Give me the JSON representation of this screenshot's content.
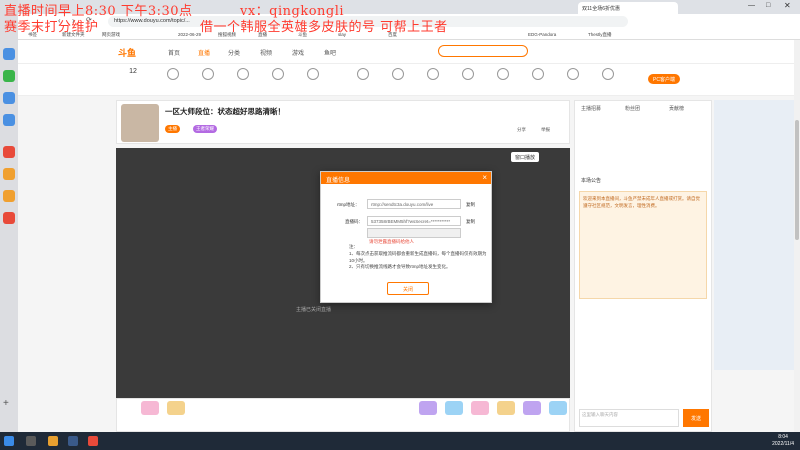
{
  "overlay": {
    "line1": "直播时间早上8:30 下午3:30点",
    "line1b": "vx：qingkongli",
    "line2": "赛季末打分维护",
    "line2b": "借一个韩服全英雄多皮肤的号 可帮上王者"
  },
  "browser": {
    "url": "https://www.douyu.com/topic/...",
    "tab_label": "双11全场6折优惠",
    "bookmarks": [
      "书签",
      "新建文件夹",
      "网页游戏",
      "2022-06-29",
      "",
      "搜狐视频",
      "直播",
      "斗鱼",
      "slay",
      "百度",
      "EDG-Pandora",
      "Thestly直播"
    ]
  },
  "site": {
    "logo": "斗鱼",
    "nav": [
      "首页",
      "直播",
      "分类",
      "视频",
      "游戏",
      "鱼吧"
    ],
    "search_placeholder": "",
    "follow_count": "12",
    "categories": [
      "",
      "",
      "",
      "",
      "",
      "",
      "",
      "",
      "",
      "",
      "",
      "",
      "",
      "",
      "",
      "",
      "",
      ""
    ],
    "pc_client_label": "PC客户端",
    "room_title": "一区大师段位：状态超好思路清晰！",
    "room_tags": [
      "主播",
      "王者荣耀",
      "分享",
      "举报"
    ],
    "window_button": "窗口播放",
    "player_hint": "主播已关闭直播"
  },
  "chat": {
    "tabs": [
      "主播招募",
      "粉丝团",
      "贡献榜"
    ],
    "announce_title": "本场公告",
    "announce_text": "欢迎来到本直播间，斗鱼严禁未成年人直播或打赏。请自觉遵守社区规范，文明发言，理性消费。",
    "input_placeholder": "这里输入聊天内容",
    "send_label": "发送"
  },
  "modal": {
    "title": "直播信息",
    "rtmp_label": "rtmp地址：",
    "rtmp_value": "rtmp://sendtc3a.douyu.com/live",
    "code_label": "直播码：",
    "code_value": "537358rBEMM5hf?wsSecret=***********",
    "copy_label": "复制",
    "warning": "请勿泄露直播码给他人",
    "notes": [
      "注：",
      "1、每次点击获取推流码都会重新生成直播码，每个直播码仅有效期为10小时。",
      "2、只有切换推流线路才会导致rtmp地址发生变化。"
    ],
    "ok_label": "关闭"
  },
  "taskbar": {
    "time": "8:04",
    "date": "2022/11/4"
  }
}
